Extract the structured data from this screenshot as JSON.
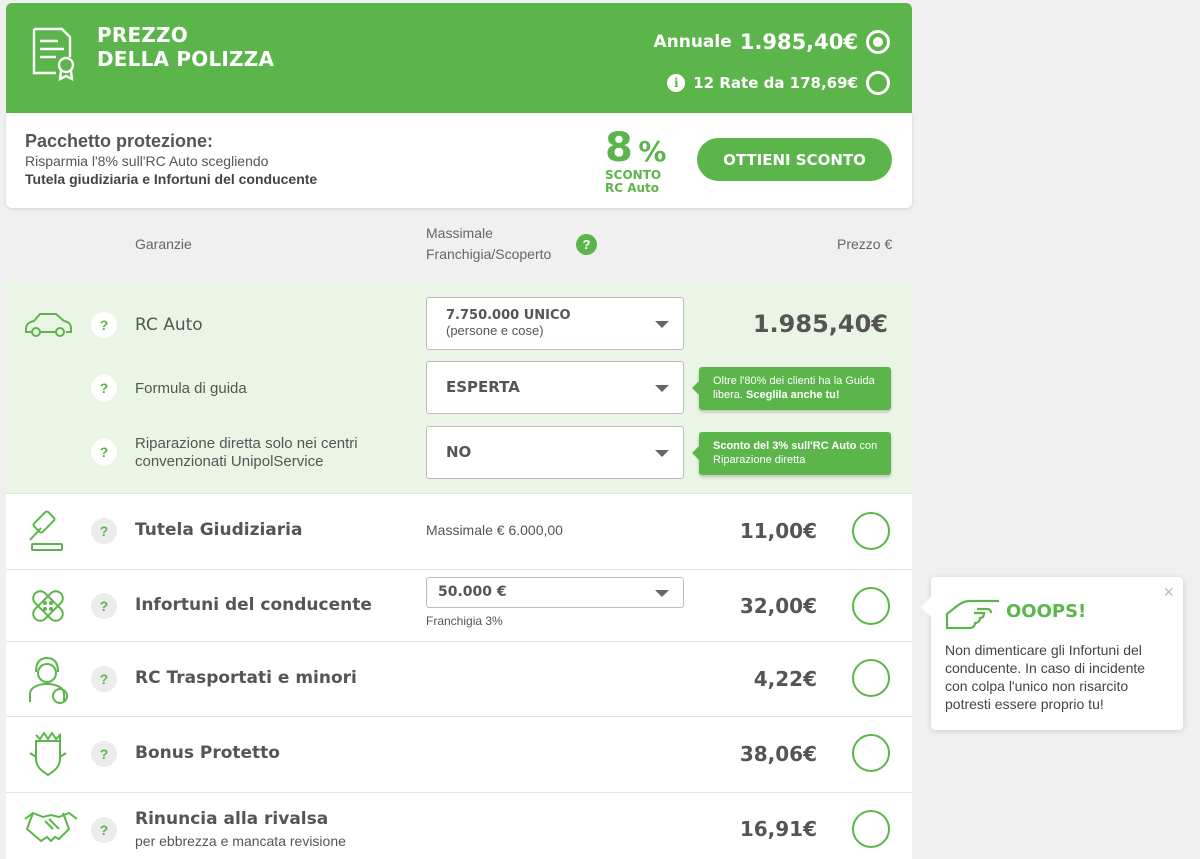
{
  "header": {
    "title_line1": "PREZZO",
    "title_line2": "DELLA POLIZZA",
    "annual_label": "Annuale",
    "annual_value": "1.985,40€",
    "info_glyph": "i",
    "rate_label": "12 Rate da 178,69€"
  },
  "promo": {
    "title": "Pacchetto protezione:",
    "line1": "Risparmia l'8% sull'RC Auto scegliendo",
    "line2": "Tutela giudiziaria e Infortuni del conducente",
    "discount_number": "8",
    "discount_percent": "%",
    "discount_label1": "SCONTO",
    "discount_label2": "RC Auto",
    "cta": "OTTIENI SCONTO"
  },
  "columns": {
    "garanzie": "Garanzie",
    "massimale_line1": "Massimale",
    "massimale_line2": "Franchigia/Scoperto",
    "help_glyph": "?",
    "prezzo": "Prezzo €"
  },
  "rc_auto": {
    "label": "RC Auto",
    "select_value": "7.750.000 UNICO",
    "select_sub": "(persone e cose)",
    "price": "1.985,40€",
    "formula_label": "Formula di guida",
    "formula_value": "ESPERTA",
    "formula_tip_normal": "Oltre l'80% dei clienti ha la Guida libera.",
    "formula_tip_bold": "Sceglila anche tu!",
    "riparazione_label1": "Riparazione diretta solo nei centri",
    "riparazione_label2": "convenzionati UnipolService",
    "riparazione_value": "NO",
    "riparazione_tip_bold": "Sconto del 3% sull'RC Auto",
    "riparazione_tip_normal": "con Riparazione diretta"
  },
  "rows": [
    {
      "label": "Tutela Giudiziaria",
      "detail": "Massimale € 6.000,00",
      "price": "11,00€",
      "icon": "gavel-icon"
    },
    {
      "label": "Infortuni del conducente",
      "select_value": "50.000 €",
      "detail": "Franchigia 3%",
      "price": "32,00€",
      "icon": "bandage-icon"
    },
    {
      "label": "RC Trasportati e minori",
      "price": "4,22€",
      "icon": "passenger-icon"
    },
    {
      "label": "Bonus Protetto",
      "price": "38,06€",
      "icon": "shield-badge-icon"
    },
    {
      "label": "Rinuncia alla rivalsa",
      "sub": "per ebbrezza e mancata revisione",
      "price": "16,91€",
      "icon": "handshake-icon"
    }
  ],
  "popup": {
    "title": "OOOPS!",
    "text": "Non dimenticare gli Infortuni del conducente. In caso di incidente con colpa l'unico non risarcito potresti essere proprio tu!",
    "close": "×"
  },
  "colors": {
    "accent": "#5cb54b",
    "rc_background": "#eaf5e6"
  }
}
